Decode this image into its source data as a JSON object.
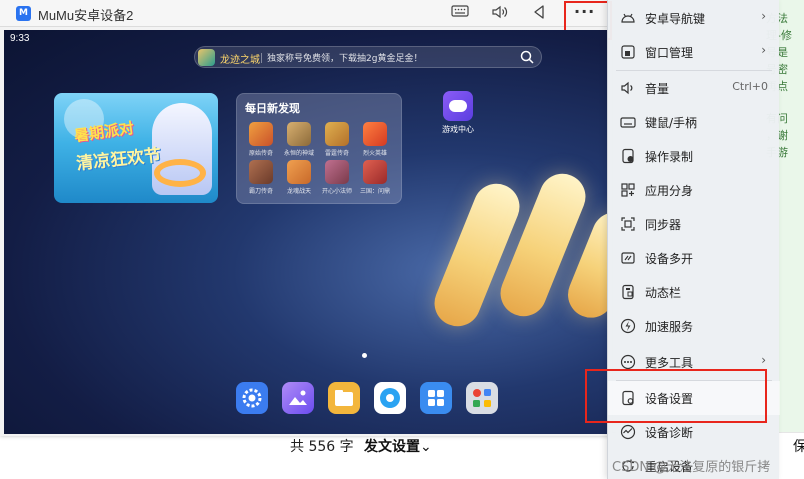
{
  "window": {
    "title": "MuMu安卓设备2",
    "logo_text": "M"
  },
  "titlebar": {
    "more_label": "···"
  },
  "android": {
    "time": "9:33",
    "search": {
      "game_name": "龙迹之城",
      "promo": "独家称号免费领，下载抽2g黄金足金！"
    },
    "banner": {
      "line1": "暑期派对",
      "line2": "清凉狂欢节"
    },
    "discover": {
      "title": "每日新发现",
      "games": [
        {
          "name": "原始传奇",
          "color": "#c9512a"
        },
        {
          "name": "永恒的神域",
          "color": "#8c6a3a"
        },
        {
          "name": "雷霆传奇",
          "color": "#b3702a"
        },
        {
          "name": "烈火英雄",
          "color": "#d43a22"
        },
        {
          "name": "霸刀传奇",
          "color": "#6a3a2a"
        },
        {
          "name": "龙魂战天",
          "color": "#c8692a"
        },
        {
          "name": "开心小法师",
          "color": "#7a3a4a"
        },
        {
          "name": "三国：问鼎",
          "color": "#9a2a2a"
        }
      ]
    },
    "game_center_label": "游戏中心",
    "dock": [
      {
        "name": "settings",
        "color": "#3b7cf0"
      },
      {
        "name": "gallery",
        "color": "#8a6cf2"
      },
      {
        "name": "files",
        "color": "#f3b63c"
      },
      {
        "name": "browser",
        "color": "#2aa3f2"
      },
      {
        "name": "app-store",
        "color": "#3a8cf0"
      },
      {
        "name": "google",
        "color": "#d9dde4"
      }
    ]
  },
  "menu": {
    "items": [
      {
        "key": "android-nav",
        "label": "安卓导航键",
        "arrow": true
      },
      {
        "key": "window-manage",
        "label": "窗口管理",
        "arrow": true
      },
      {
        "key": "volume",
        "label": "音量",
        "shortcut": "Ctrl+0"
      },
      {
        "key": "keyboard-gamepad",
        "label": "键鼠/手柄"
      },
      {
        "key": "macro-record",
        "label": "操作录制"
      },
      {
        "key": "app-clone",
        "label": "应用分身"
      },
      {
        "key": "synchronizer",
        "label": "同步器"
      },
      {
        "key": "multi-instance",
        "label": "设备多开"
      },
      {
        "key": "dynamic-bar",
        "label": "动态栏"
      },
      {
        "key": "boost-service",
        "label": "加速服务"
      },
      {
        "key": "more-tools",
        "label": "更多工具",
        "arrow": true
      },
      {
        "key": "device-settings",
        "label": "设备设置"
      },
      {
        "key": "device-diagnose",
        "label": "设备诊断"
      },
      {
        "key": "restart-device",
        "label": "重启设备"
      }
    ]
  },
  "editor": {
    "word_count_prefix": "共",
    "word_count": "556",
    "word_count_suffix": "字",
    "publish_settings": "发文设置",
    "right_glyph": "保",
    "watermark": "CSDN @无法复原的银斤拷",
    "side_text": [
      "方法",
      "理-修",
      "号是",
      "号密",
      "再点",
      "",
      "有问",
      "，谢",
      "手游"
    ]
  },
  "colors": {
    "highlight_red": "#e8261c",
    "accent_blue": "#2a73f0"
  }
}
